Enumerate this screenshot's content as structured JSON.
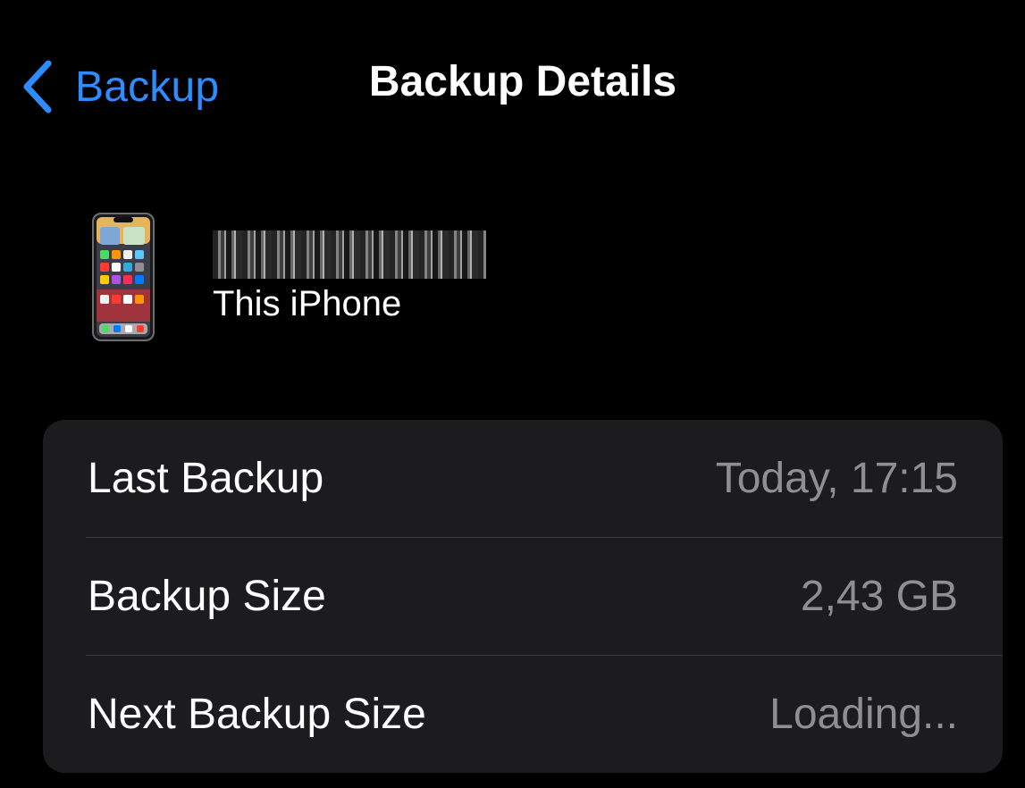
{
  "nav": {
    "back_label": "Backup",
    "title": "Backup Details",
    "back_icon": "chevron-left-icon"
  },
  "device": {
    "icon": "iphone-icon",
    "name_redacted": true,
    "subtitle": "This iPhone"
  },
  "info_rows": [
    {
      "label": "Last Backup",
      "value": "Today, 17:15"
    },
    {
      "label": "Backup Size",
      "value": "2,43 GB"
    },
    {
      "label": "Next Backup Size",
      "value": "Loading..."
    }
  ],
  "colors": {
    "background": "#000000",
    "accent": "#2f8cff",
    "group_background": "#1c1c1e",
    "secondary_text": "#8e8e93",
    "divider": "#3a3a3c"
  }
}
